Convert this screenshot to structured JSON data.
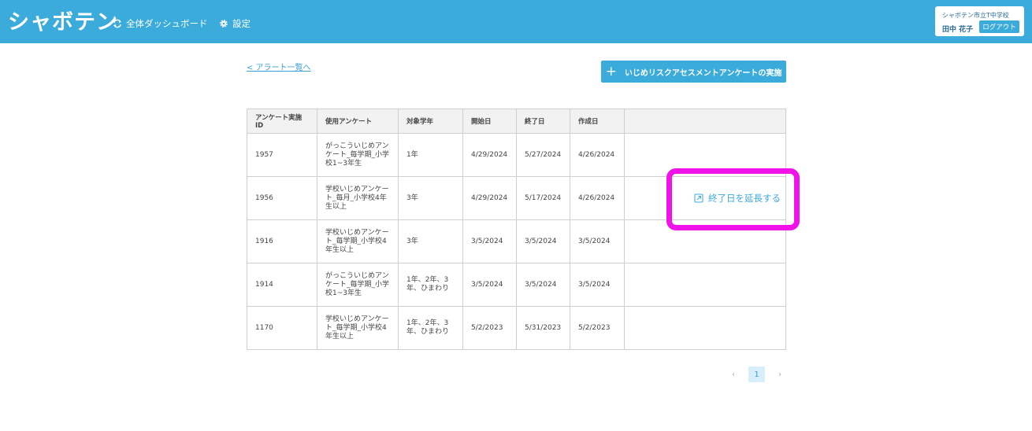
{
  "header": {
    "logo": "シャボテン",
    "nav": [
      {
        "label": "全体ダッシュボード",
        "icon": "refresh-icon"
      },
      {
        "label": "設定",
        "icon": "gear-icon"
      }
    ],
    "user": {
      "school": "シャボテン市立T中学校",
      "name": "田中 花子",
      "logout_label": "ログアウト"
    }
  },
  "back_link": "< アラート一覧へ",
  "action_button": {
    "label": "いじめリスクアセスメントアンケートの実施",
    "icon": "plus-icon"
  },
  "table": {
    "columns": [
      "アンケート実施ID",
      "使用アンケート",
      "対象学年",
      "開始日",
      "終了日",
      "作成日",
      ""
    ],
    "rows": [
      {
        "id": "1957",
        "survey": "がっこういじめアンケート_毎学期_小学校1~3年生",
        "grade": "1年",
        "start": "4/29/2024",
        "end": "5/27/2024",
        "created": "4/26/2024"
      },
      {
        "id": "1956",
        "survey": "学校いじめアンケート_毎月_小学校4年生以上",
        "grade": "3年",
        "start": "4/29/2024",
        "end": "5/17/2024",
        "created": "4/26/2024"
      },
      {
        "id": "1916",
        "survey": "学校いじめアンケート_毎学期_小学校4年生以上",
        "grade": "3年",
        "start": "3/5/2024",
        "end": "3/5/2024",
        "created": "3/5/2024"
      },
      {
        "id": "1914",
        "survey": "がっこういじめアンケート_毎学期_小学校1~3年生",
        "grade": "1年、2年、3年、ひまわり",
        "start": "3/5/2024",
        "end": "3/5/2024",
        "created": "3/5/2024"
      },
      {
        "id": "1170",
        "survey": "学校いじめアンケート_毎学期_小学校4年生以上",
        "grade": "1年、2年、3年、ひまわり",
        "start": "5/2/2023",
        "end": "5/31/2023",
        "created": "5/2/2023"
      }
    ]
  },
  "extend_link": {
    "label": "終了日を延長する",
    "icon": "external-link-icon"
  },
  "highlight_color": "#f012e8",
  "pagination": {
    "prev": "‹",
    "current": "1",
    "next": "›"
  }
}
